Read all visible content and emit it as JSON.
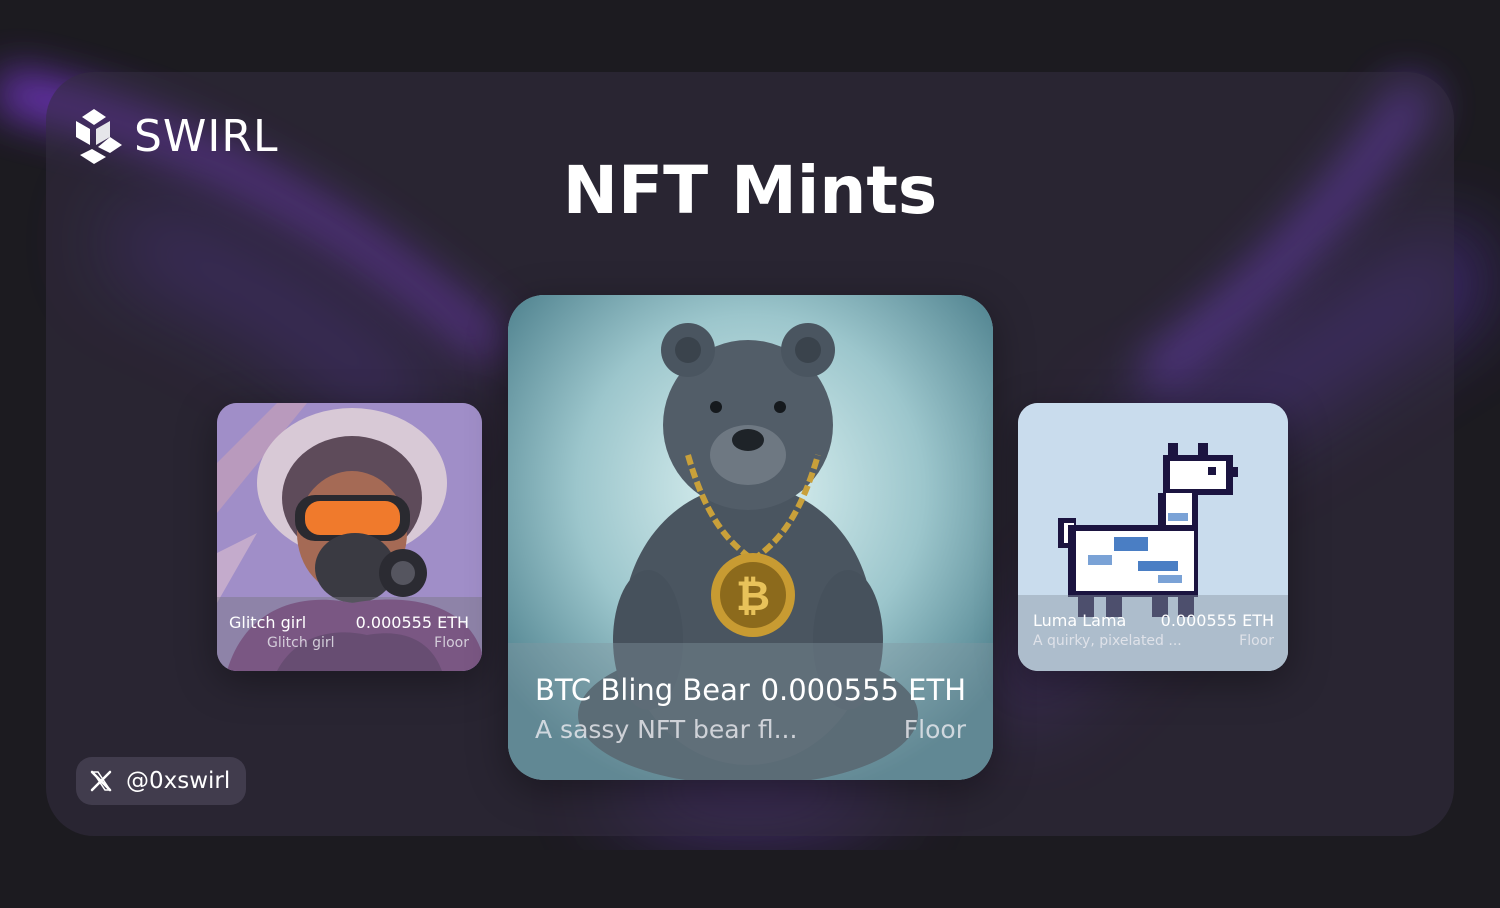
{
  "brand": {
    "name": "SWIRL",
    "logo_icon": "swirl-logo-icon"
  },
  "page": {
    "title": "NFT Mints"
  },
  "colors": {
    "background": "#1c1b20",
    "accent_glow": "#7c3aed",
    "text": "#ffffff"
  },
  "cards": {
    "left": {
      "name": "Glitch girl",
      "price": "0.000555 ETH",
      "description": "Glitch girl",
      "price_label": "Floor"
    },
    "center": {
      "name": "BTC Bling Bear",
      "price": "0.000555 ETH",
      "description": "A sassy NFT bear fl...",
      "price_label": "Floor"
    },
    "right": {
      "name": "Luma Lama",
      "price": "0.000555 ETH",
      "description": "A quirky, pixelated ...",
      "price_label": "Floor"
    }
  },
  "social": {
    "icon": "x-icon",
    "handle": "@0xswirl"
  }
}
